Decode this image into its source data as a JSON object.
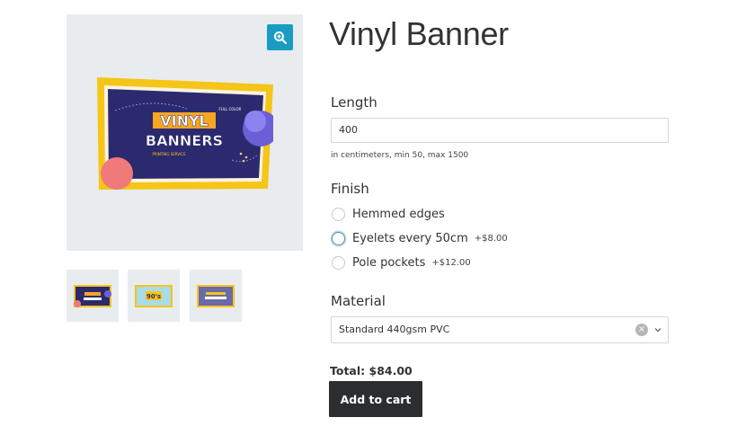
{
  "product": {
    "title": "Vinyl Banner",
    "image_text": {
      "line1": "VINYL",
      "line2": "BANNERS",
      "tag": "FULL COLOR",
      "sub": "PRINTING SERVICE"
    },
    "thumb2_text": "90's"
  },
  "length": {
    "label": "Length",
    "value": "400",
    "hint": "in centimeters, min 50, max 1500"
  },
  "finish": {
    "label": "Finish",
    "options": [
      {
        "label": "Hemmed edges",
        "price": ""
      },
      {
        "label": "Eyelets every 50cm",
        "price": "+$8.00"
      },
      {
        "label": "Pole pockets",
        "price": "+$12.00"
      }
    ]
  },
  "material": {
    "label": "Material",
    "selected": "Standard 440gsm PVC",
    "clear_glyph": "×"
  },
  "cart": {
    "total": "Total: $84.00",
    "button": "Add to cart"
  },
  "icons": {
    "zoom": "magnifier-plus-icon",
    "chevron": "chevron-down-icon",
    "clear": "clear-icon"
  },
  "colors": {
    "accent": "#1a9cc2",
    "button": "#2b2d2f",
    "banner_frame": "#f5c518",
    "banner_bg": "#2c2a6e"
  }
}
